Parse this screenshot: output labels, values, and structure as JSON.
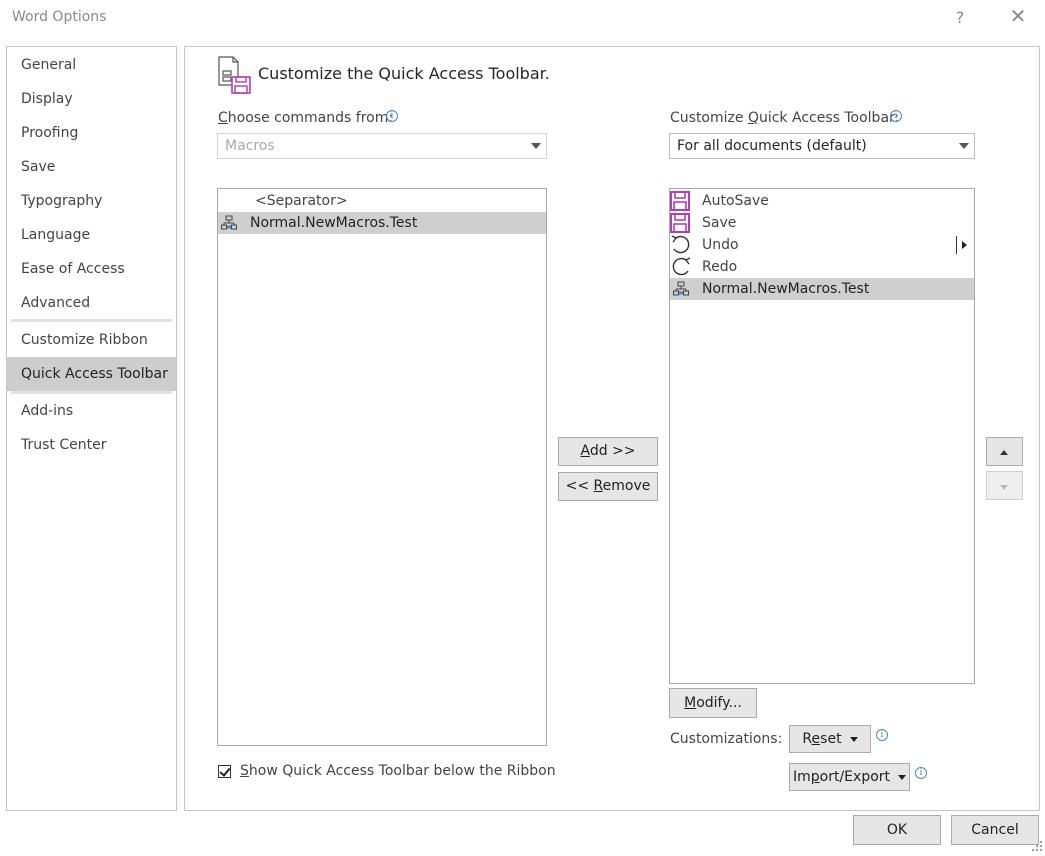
{
  "window": {
    "title": "Word Options",
    "help_glyph": "?",
    "close_glyph": "✕"
  },
  "sidebar": {
    "items": [
      {
        "label": "General"
      },
      {
        "label": "Display"
      },
      {
        "label": "Proofing"
      },
      {
        "label": "Save"
      },
      {
        "label": "Typography"
      },
      {
        "label": "Language"
      },
      {
        "label": "Ease of Access"
      },
      {
        "label": "Advanced"
      },
      {
        "label": "Customize Ribbon"
      },
      {
        "label": "Quick Access Toolbar",
        "selected": true
      },
      {
        "label": "Add-ins"
      },
      {
        "label": "Trust Center"
      }
    ]
  },
  "main": {
    "heading": "Customize the Quick Access Toolbar.",
    "choose_label_accel": "C",
    "choose_label_rest": "hoose commands from:",
    "choose_value": "Macros",
    "customize_label_pre": "Customize ",
    "customize_label_accel": "Q",
    "customize_label_post": "uick Access Toolbar:",
    "customize_value": "For all documents (default)",
    "left_list": [
      {
        "label": "<Separator>",
        "icon": null
      },
      {
        "label": "Normal.NewMacros.Test",
        "icon": "macro-icon",
        "selected": true
      }
    ],
    "right_list": [
      {
        "label": "AutoSave",
        "icon": "autosave-icon"
      },
      {
        "label": "Save",
        "icon": "save-icon"
      },
      {
        "label": "Undo",
        "icon": "undo-icon"
      },
      {
        "label": "Redo",
        "icon": "redo-icon"
      },
      {
        "label": "Normal.NewMacros.Test",
        "icon": "macro-icon",
        "selected": true
      }
    ],
    "add_accel": "A",
    "add_rest": "dd >>",
    "remove_pre": "<< ",
    "remove_accel": "R",
    "remove_rest": "emove",
    "modify_accel": "M",
    "modify_rest": "odify...",
    "customizations_label": "Customizations:",
    "reset_pre": "R",
    "reset_accel": "e",
    "reset_rest": "set",
    "import_pre": "Im",
    "import_accel": "p",
    "import_rest": "ort/Export",
    "show_below_accel": "S",
    "show_below_rest": "how Quick Access Toolbar below the Ribbon",
    "show_below_checked": true,
    "info_glyph": "i"
  },
  "footer": {
    "ok_label": "OK",
    "cancel_label": "Cancel"
  },
  "colors": {
    "selection": "#cdcdcd",
    "save_icon": "#b13fb0",
    "info_icon": "#4a86c8"
  }
}
